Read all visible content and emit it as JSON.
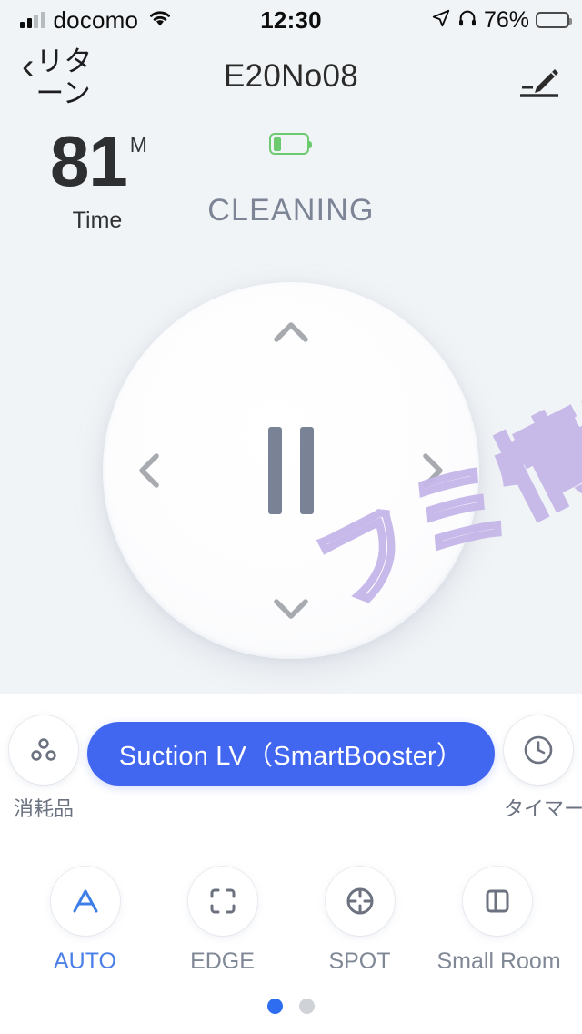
{
  "status_bar": {
    "carrier": "docomo",
    "time": "12:30",
    "battery_percent": "76%",
    "icons": [
      "signal-bars-icon",
      "wifi-icon",
      "location-arrow-icon",
      "headphones-icon",
      "battery-icon"
    ]
  },
  "nav": {
    "back_chevron": "‹",
    "back_label": "リターン",
    "title": "E20No08",
    "edit_icon": "pencil-edit-icon"
  },
  "stats": {
    "time_value": "81",
    "time_unit": "M",
    "time_label": "Time",
    "battery_icon": "robot-battery-icon",
    "battery_level_percent": 25,
    "battery_color": "#6ccb6e",
    "status": "CLEANING",
    "status_color": "#7c8496"
  },
  "dpad": {
    "up_icon": "chevron-up-icon",
    "down_icon": "chevron-down-icon",
    "left_icon": "chevron-left-icon",
    "right_icon": "chevron-right-icon",
    "center_icon": "pause-icon",
    "center_state": "pause"
  },
  "panel": {
    "consumables": {
      "label": "消耗品",
      "icon": "consumables-dots-icon"
    },
    "timer": {
      "label": "タイマー",
      "icon": "clock-icon"
    },
    "suction": {
      "label": "Suction LV（SmartBooster）",
      "color": "#4166f0"
    },
    "modes": [
      {
        "label": "AUTO",
        "icon": "letter-a-icon",
        "active": true
      },
      {
        "label": "EDGE",
        "icon": "frame-corners-icon",
        "active": false
      },
      {
        "label": "SPOT",
        "icon": "crosshair-target-icon",
        "active": false
      },
      {
        "label": "Small Room",
        "icon": "split-panel-icon",
        "active": false
      }
    ],
    "pagination": {
      "count": 2,
      "active_index": 0,
      "active_color": "#2f6df0"
    }
  },
  "watermark": {
    "text": "フミ情報",
    "color": "#c5b6e8"
  },
  "theme": {
    "background": "#f1f4f6",
    "panel_background": "#ffffff",
    "accent": "#4166f0"
  }
}
